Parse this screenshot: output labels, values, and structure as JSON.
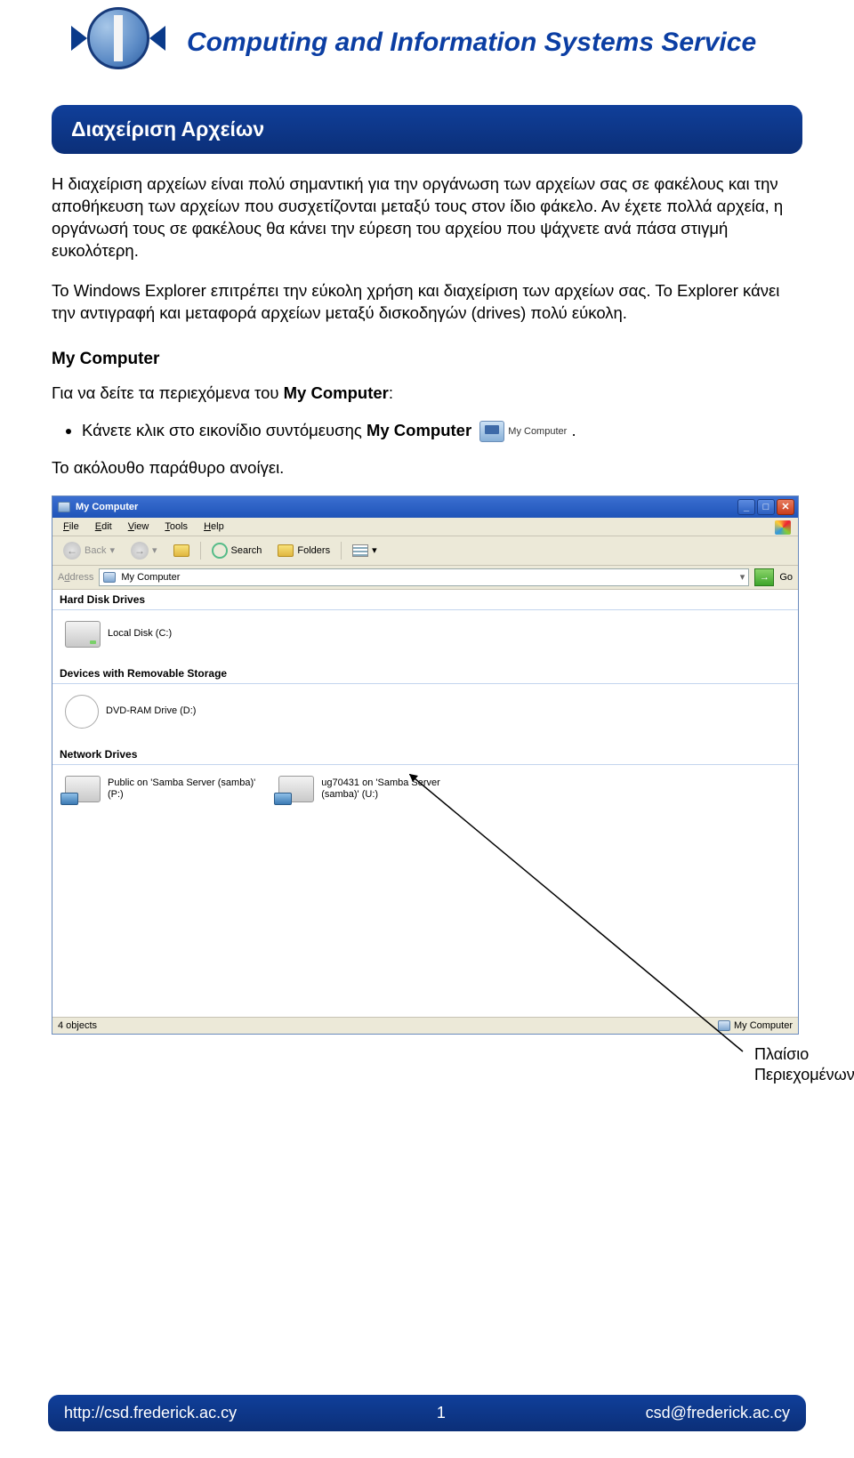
{
  "header": {
    "title": "Computing and Information Systems Service"
  },
  "banner": {
    "title": "Διαχείριση Αρχείων"
  },
  "paragraphs": {
    "p1": "Η διαχείριση αρχείων είναι πολύ σημαντική για την οργάνωση των αρχείων σας σε φακέλους και την αποθήκευση των αρχείων που συσχετίζονται μεταξύ τους στον ίδιο φάκελο. Αν έχετε πολλά αρχεία, η οργάνωσή τους σε φακέλους θα κάνει την εύρεση του αρχείου που ψάχνετε ανά πάσα στιγμή ευκολότερη.",
    "p2": "Το Windows Explorer επιτρέπει την εύκολη χρήση και διαχείριση των αρχείων σας. Το Explorer κάνει την αντιγραφή και μεταφορά αρχείων μεταξύ δισκοδηγών (drives) πολύ εύκολη."
  },
  "section": {
    "heading": "My Computer",
    "intro_pre": "Για να δείτε τα περιεχόμενα του ",
    "intro_bold": "My Computer",
    "intro_post": ":",
    "bullet_pre": "Κάνετε κλικ στο εικονίδιο συντόμευσης ",
    "bullet_bold": "My Computer",
    "shortcut_label": "My Computer",
    "after": "Το ακόλουθο παράθυρο ανοίγει."
  },
  "win": {
    "title": "My Computer",
    "menu": {
      "file": "File",
      "edit": "Edit",
      "view": "View",
      "tools": "Tools",
      "help": "Help"
    },
    "toolbar": {
      "back": "Back",
      "search": "Search",
      "folders": "Folders"
    },
    "address_label": "Address",
    "address_value": "My Computer",
    "go": "Go",
    "groups": {
      "hdd": "Hard Disk Drives",
      "removable": "Devices with Removable Storage",
      "network": "Network Drives"
    },
    "drives": {
      "local": "Local Disk (C:)",
      "dvd": "DVD-RAM Drive (D:)",
      "net1a": "Public on 'Samba Server (samba)'",
      "net1b": "(P:)",
      "net2a": "ug70431 on 'Samba Server",
      "net2b": "(samba)' (U:)"
    },
    "status": {
      "left": "4 objects",
      "right": "My Computer"
    }
  },
  "callout": {
    "l1": "Πλαίσιο",
    "l2": "Περιεχομένων"
  },
  "footer": {
    "url": "http://csd.frederick.ac.cy",
    "page": "1",
    "email": "csd@frederick.ac.cy"
  }
}
